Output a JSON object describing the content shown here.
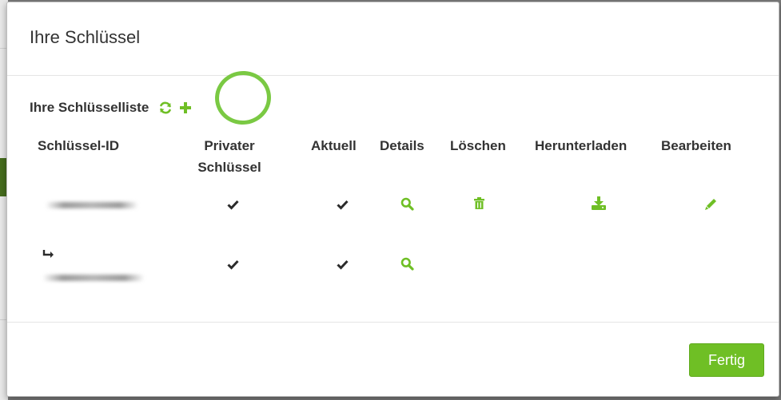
{
  "colors": {
    "accent": "#6fbf25",
    "highlight": "#7ac943",
    "text": "#333333"
  },
  "modal": {
    "title": "Ihre Schlüssel",
    "list_title": "Ihre Schlüsselliste",
    "icons": {
      "refresh": "refresh-icon",
      "add": "plus-icon"
    }
  },
  "table": {
    "headers": {
      "key_id": "Schlüssel-ID",
      "private_key_line1": "Privater",
      "private_key_line2": "Schlüssel",
      "current": "Aktuell",
      "details": "Details",
      "delete": "Löschen",
      "download": "Herunterladen",
      "edit": "Bearbeiten"
    },
    "rows": [
      {
        "key_id_visible": false,
        "private_key": true,
        "current": true,
        "details": true,
        "delete": true,
        "download": true,
        "edit": true
      },
      {
        "sub_key": true,
        "key_id_visible": false,
        "private_key": true,
        "current": true,
        "details": true,
        "delete": false,
        "download": false,
        "edit": false
      }
    ]
  },
  "footer": {
    "done_label": "Fertig"
  }
}
